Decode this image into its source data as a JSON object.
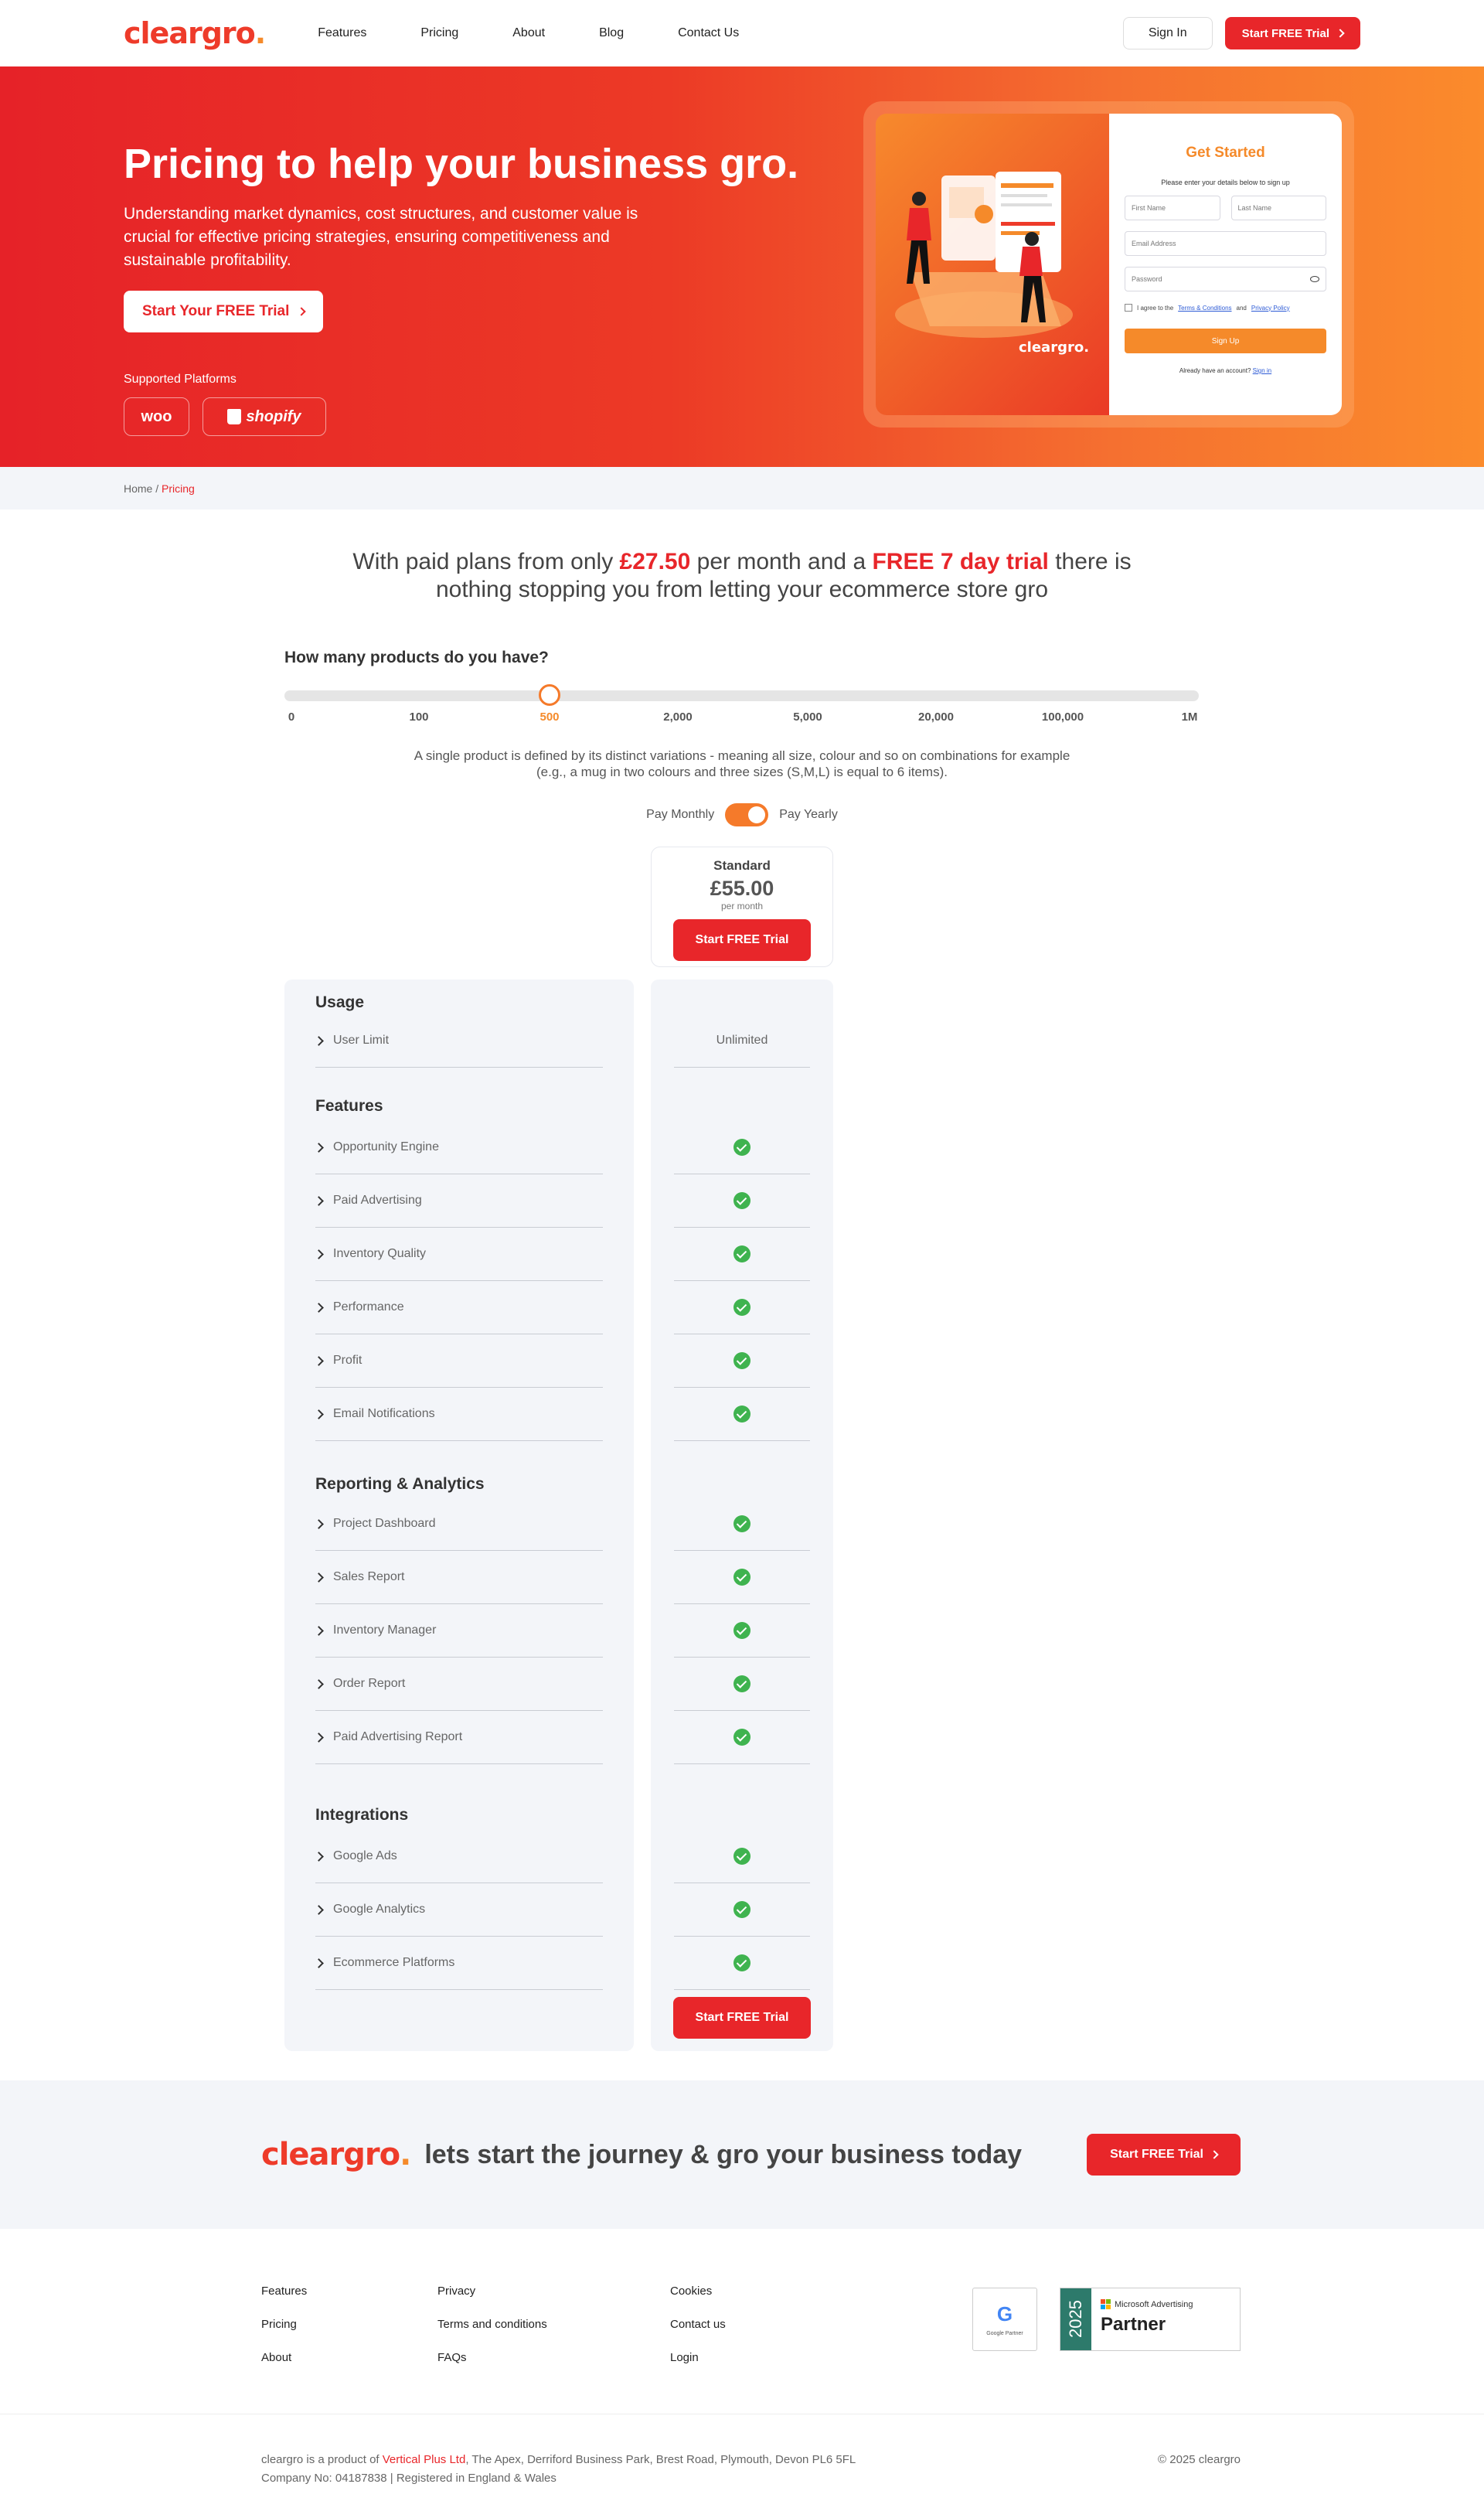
{
  "nav": {
    "logo": "cleargro",
    "logo_dot": ".",
    "links": [
      "Features",
      "Pricing",
      "About",
      "Blog",
      "Contact Us"
    ],
    "sign_in": "Sign In",
    "trial": "Start FREE Trial"
  },
  "hero": {
    "title": "Pricing to help your business gro.",
    "subtitle": "Understanding market dynamics, cost structures, and customer value is crucial for effective pricing strategies, ensuring competitiveness and sustainable profitability.",
    "cta": "Start Your FREE Trial",
    "platforms_label": "Supported Platforms",
    "platforms": [
      "woo",
      "shopify"
    ],
    "illustration_logo": "cleargro."
  },
  "signup": {
    "title": "Get Started",
    "subtitle": "Please enter your details below to sign up",
    "first_name": "First Name",
    "last_name": "Last Name",
    "email": "Email Address",
    "password": "Password",
    "agree_prefix": "I agree to the",
    "terms": "Terms & Conditions",
    "and": "and",
    "privacy": "Privacy Policy",
    "button": "Sign Up",
    "footer_text": "Already have an account?",
    "footer_link": "Sign in"
  },
  "breadcrumb": {
    "home": "Home",
    "sep": " / ",
    "current": "Pricing"
  },
  "intro": {
    "p1": "With paid plans from only ",
    "price": "£27.50",
    "p2": " per month and a ",
    "trial": "FREE 7 day trial",
    "p3": " there is",
    "line2": "nothing stopping you from letting your ecommerce store gro"
  },
  "products": {
    "question": "How many products do you have?",
    "ticks": [
      "0",
      "100",
      "500",
      "2,000",
      "5,000",
      "20,000",
      "100,000",
      "1M"
    ],
    "selected_index": 2,
    "note_line1": "A single product is defined by its distinct variations - meaning all size, colour and so on combinations for example",
    "note_line2": "(e.g., a mug in two colours and three sizes (S,M,L) is equal to 6 items)."
  },
  "billing": {
    "monthly": "Pay Monthly",
    "yearly": "Pay Yearly",
    "yearly_selected": true
  },
  "plan": {
    "name": "Standard",
    "price": "£55.00",
    "per": "per month",
    "cta": "Start FREE Trial"
  },
  "sections": [
    {
      "title": "Usage",
      "rows": [
        {
          "label": "User Limit",
          "value": "Unlimited"
        }
      ]
    },
    {
      "title": "Features",
      "rows": [
        {
          "label": "Opportunity Engine",
          "value": "check"
        },
        {
          "label": "Paid Advertising",
          "value": "check"
        },
        {
          "label": "Inventory Quality",
          "value": "check"
        },
        {
          "label": "Performance",
          "value": "check"
        },
        {
          "label": "Profit",
          "value": "check"
        },
        {
          "label": "Email Notifications",
          "value": "check"
        }
      ]
    },
    {
      "title": "Reporting & Analytics",
      "rows": [
        {
          "label": "Project Dashboard",
          "value": "check"
        },
        {
          "label": "Sales Report",
          "value": "check"
        },
        {
          "label": "Inventory Manager",
          "value": "check"
        },
        {
          "label": "Order Report",
          "value": "check"
        },
        {
          "label": "Paid Advertising Report",
          "value": "check"
        }
      ]
    },
    {
      "title": "Integrations",
      "rows": [
        {
          "label": "Google Ads",
          "value": "check"
        },
        {
          "label": "Google Analytics",
          "value": "check"
        },
        {
          "label": "Ecommerce Platforms",
          "value": "check"
        }
      ]
    }
  ],
  "banner": {
    "logo": "cleargro",
    "logo_dot": ".",
    "text": "lets start the journey & gro your business today",
    "cta": "Start FREE Trial"
  },
  "footer": {
    "col1": [
      "Features",
      "Pricing",
      "About"
    ],
    "col2": [
      "Privacy",
      "Terms and conditions",
      "FAQs"
    ],
    "col3": [
      "Cookies",
      "Contact us",
      "Login"
    ],
    "google_badge": "Google Partner",
    "ms_year": "2025",
    "ms_top": "Microsoft Advertising",
    "ms_partner": "Partner",
    "legal_prefix": "cleargro is a product of ",
    "legal_company": "Vertical Plus Ltd",
    "legal_address": ", The Apex, Derriford Business Park, Brest Road, Plymouth, Devon PL6 5FL",
    "legal_line2": "Company No: 04187838 | Registered in England & Wales",
    "copyright": "© 2025 cleargro"
  },
  "colors": {
    "brand_red": "#e8262a",
    "brand_orange": "#f58a2a",
    "check_green": "#3fb34f"
  }
}
